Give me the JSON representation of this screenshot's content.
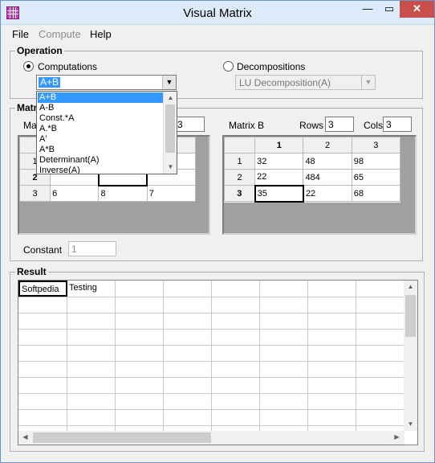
{
  "window": {
    "title": "Visual Matrix",
    "min": "—",
    "max": "▭",
    "close": "✕"
  },
  "menu": {
    "file": "File",
    "compute": "Compute",
    "help": "Help"
  },
  "operation": {
    "group_label": "Operation",
    "computations_label": "Computations",
    "computations_selected": "A+B",
    "decompositions_label": "Decompositions",
    "decompositions_selected": "LU Decomposition(A)",
    "options": [
      "A+B",
      "A-B",
      "Const.*A",
      "A.*B",
      "A'",
      "A*B",
      "Determinant(A)",
      "Inverse(A)"
    ]
  },
  "matrices": {
    "group_label": "Matri",
    "matrix_a": {
      "label": "Ma",
      "cols_value": "3",
      "row3": [
        "3",
        "6",
        "8",
        "7"
      ],
      "row2_header": "2",
      "row1_header": "1"
    },
    "matrix_b": {
      "label": "Matrix B",
      "rows_label": "Rows",
      "rows_value": "3",
      "cols_label": "Cols",
      "cols_value": "3",
      "col_headers": [
        "1",
        "2",
        "3"
      ],
      "rows": [
        [
          "1",
          "32",
          "48",
          "98"
        ],
        [
          "2",
          "22",
          "484",
          "65"
        ],
        [
          "3",
          "35",
          "22",
          "68"
        ]
      ]
    },
    "constant_label": "Constant",
    "constant_value": "1"
  },
  "result": {
    "group_label": "Result",
    "cells": [
      "Softpedia",
      "Testing"
    ]
  },
  "icons": {
    "up": "▲",
    "down": "▼",
    "left": "◀",
    "right": "▶"
  }
}
